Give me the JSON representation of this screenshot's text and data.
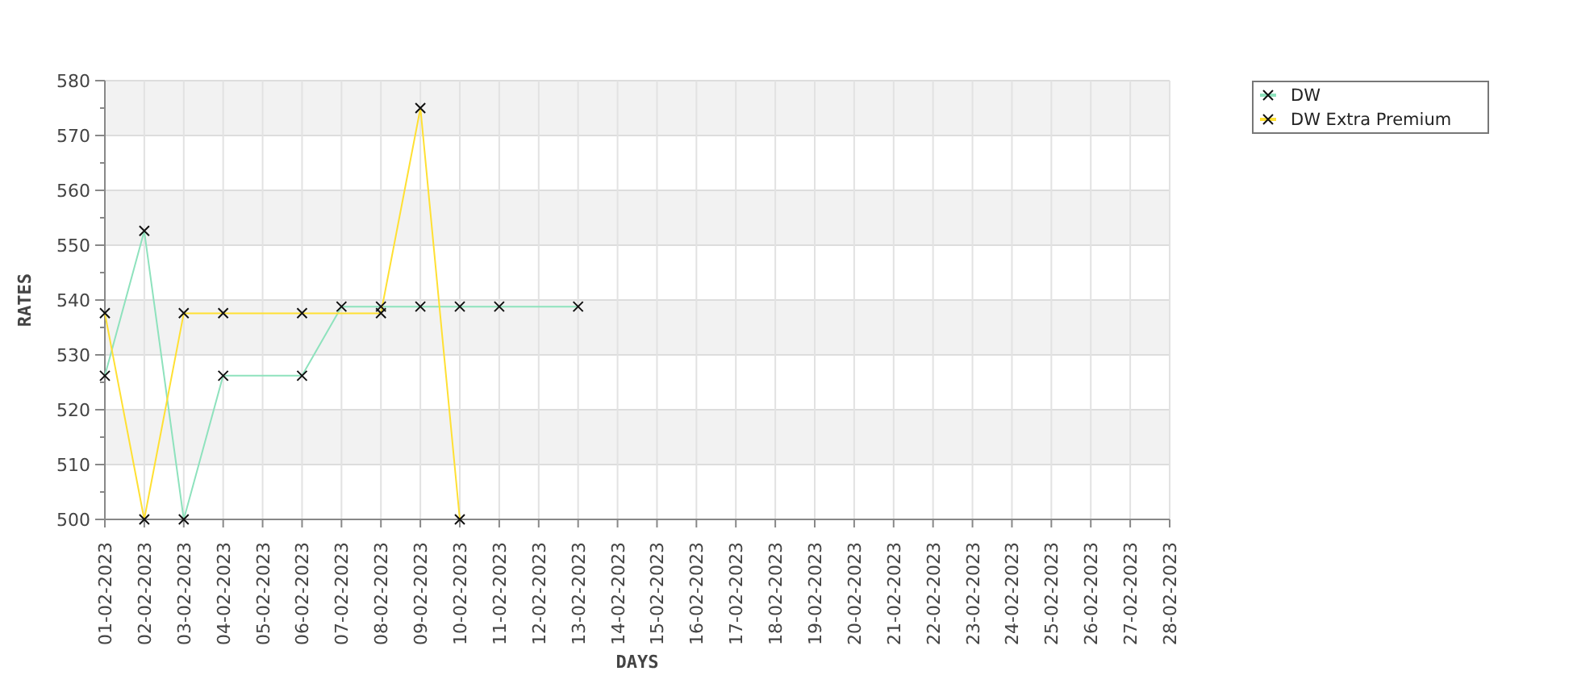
{
  "chart_data": {
    "type": "line",
    "xlabel": "DAYS",
    "ylabel": "RATES",
    "grid": true,
    "legend": true,
    "categories": [
      "01-02-2023",
      "02-02-2023",
      "03-02-2023",
      "04-02-2023",
      "05-02-2023",
      "06-02-2023",
      "07-02-2023",
      "08-02-2023",
      "09-02-2023",
      "10-02-2023",
      "11-02-2023",
      "12-02-2023",
      "13-02-2023",
      "14-02-2023",
      "15-02-2023",
      "16-02-2023",
      "17-02-2023",
      "18-02-2023",
      "19-02-2023",
      "20-02-2023",
      "21-02-2023",
      "22-02-2023",
      "23-02-2023",
      "24-02-2023",
      "25-02-2023",
      "26-02-2023",
      "27-02-2023",
      "28-02-2023"
    ],
    "series": [
      {
        "name": "DW",
        "color": "#8ee2bd",
        "marker": "x",
        "values": [
          526.2,
          552.6,
          500,
          526.2,
          null,
          526.2,
          538.8,
          538.8,
          538.8,
          538.8,
          538.8,
          null,
          538.8,
          null,
          null,
          null,
          null,
          null,
          null,
          null,
          null,
          null,
          null,
          null,
          null,
          null,
          null,
          null
        ]
      },
      {
        "name": "DW Extra Premium",
        "color": "#ffe033",
        "marker": "x",
        "values": [
          537.6,
          500,
          537.6,
          537.6,
          null,
          537.6,
          null,
          537.6,
          575,
          500,
          null,
          null,
          null,
          null,
          null,
          null,
          null,
          null,
          null,
          null,
          null,
          null,
          null,
          null,
          null,
          null,
          null,
          null
        ]
      }
    ],
    "ylim": [
      500,
      580
    ],
    "yticks": [
      500,
      510,
      520,
      530,
      540,
      550,
      560,
      570,
      580
    ]
  }
}
